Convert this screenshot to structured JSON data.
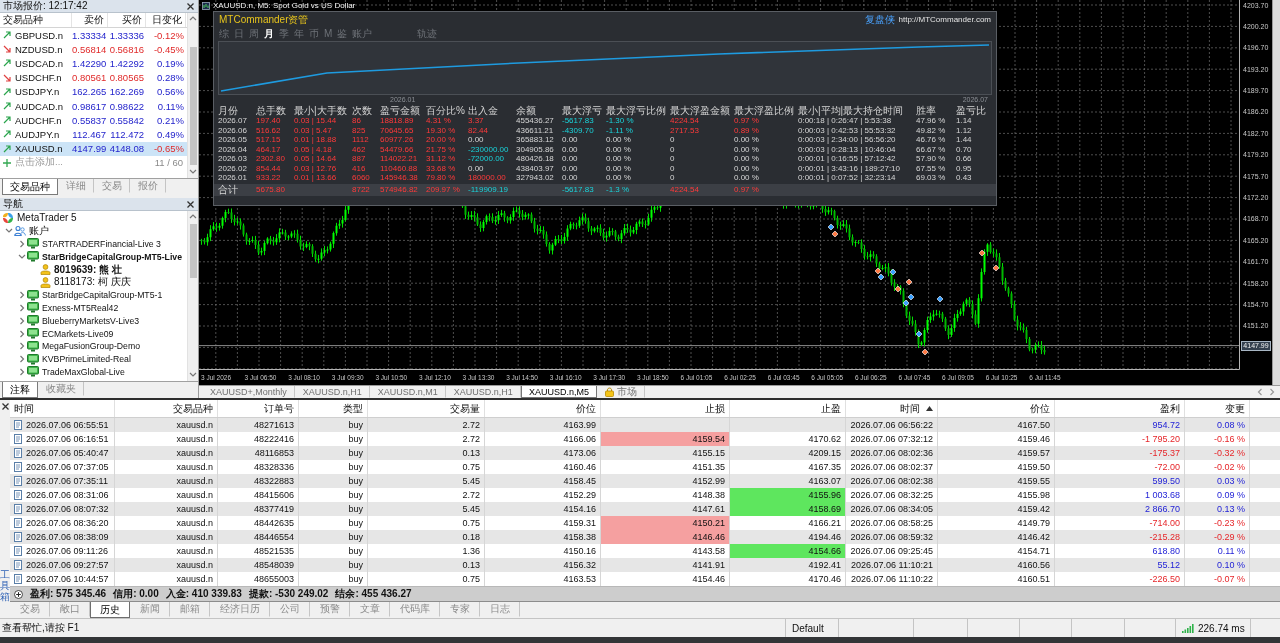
{
  "market_watch": {
    "title": "市场报价: 12:17:42",
    "columns": [
      "交易品种",
      "卖价",
      "买价",
      "日变化"
    ],
    "rows": [
      {
        "symbol": "GBPUSD.n",
        "bid": "1.33334",
        "ask": "1.33336",
        "change": "-0.12%",
        "price_up": true,
        "change_up": false,
        "selected": false
      },
      {
        "symbol": "NZDUSD.n",
        "bid": "0.56814",
        "ask": "0.56816",
        "change": "-0.45%",
        "price_up": false,
        "change_up": false,
        "selected": false
      },
      {
        "symbol": "USDCAD.n",
        "bid": "1.42290",
        "ask": "1.42292",
        "change": "0.19%",
        "price_up": true,
        "change_up": true,
        "selected": false
      },
      {
        "symbol": "USDCHF.n",
        "bid": "0.80561",
        "ask": "0.80565",
        "change": "0.28%",
        "price_up": false,
        "change_up": true,
        "selected": false
      },
      {
        "symbol": "USDJPY.n",
        "bid": "162.265",
        "ask": "162.269",
        "change": "0.56%",
        "price_up": true,
        "change_up": true,
        "selected": false
      },
      {
        "symbol": "AUDCAD.n",
        "bid": "0.98617",
        "ask": "0.98622",
        "change": "0.11%",
        "price_up": true,
        "change_up": true,
        "selected": false
      },
      {
        "symbol": "AUDCHF.n",
        "bid": "0.55837",
        "ask": "0.55842",
        "change": "0.21%",
        "price_up": true,
        "change_up": true,
        "selected": false
      },
      {
        "symbol": "AUDJPY.n",
        "bid": "112.467",
        "ask": "112.472",
        "change": "0.49%",
        "price_up": true,
        "change_up": true,
        "selected": false
      },
      {
        "symbol": "XAUUSD.n",
        "bid": "4147.99",
        "ask": "4148.08",
        "change": "-0.65%",
        "price_up": true,
        "change_up": false,
        "selected": true
      }
    ],
    "add_label": "点击添加...",
    "count": "11 / 60",
    "tabs": [
      {
        "label": "交易品种",
        "selected": true
      },
      {
        "label": "详细",
        "selected": false
      },
      {
        "label": "交易",
        "selected": false
      },
      {
        "label": "报价",
        "selected": false
      }
    ]
  },
  "navigator": {
    "title": "导航",
    "tree": [
      {
        "label": "MetaTrader 5",
        "kind": "app",
        "children": [
          {
            "label": "账户",
            "kind": "folder",
            "expanded": true,
            "children": [
              {
                "label": "STARTRADERFinancial-Live 3",
                "kind": "server",
                "expanded": false,
                "active": false
              },
              {
                "label": "StarBridgeCapitalGroup-MT5-Live",
                "kind": "server",
                "expanded": true,
                "active": true,
                "children": [
                  {
                    "label": "8019639: 熊 壮",
                    "kind": "account",
                    "active": true
                  },
                  {
                    "label": "8118173: 柯 庆庆",
                    "kind": "account",
                    "active": false
                  }
                ]
              },
              {
                "label": "StarBridgeCapitalGroup-MT5-1",
                "kind": "server",
                "expanded": false,
                "active": false
              },
              {
                "label": "Exness-MT5Real42",
                "kind": "server",
                "expanded": false,
                "active": false
              },
              {
                "label": "BlueberryMarketsV-Live3",
                "kind": "server",
                "expanded": false,
                "active": false
              },
              {
                "label": "ECMarkets-Live09",
                "kind": "server",
                "expanded": false,
                "active": false
              },
              {
                "label": "MegaFusionGroup-Demo",
                "kind": "server",
                "expanded": false,
                "active": false
              },
              {
                "label": "KVBPrimeLimited-Real",
                "kind": "server",
                "expanded": false,
                "active": false
              },
              {
                "label": "TradeMaxGlobal-Live",
                "kind": "server",
                "expanded": false,
                "active": false
              }
            ]
          }
        ]
      }
    ],
    "tabs": [
      {
        "label": "注释",
        "selected": true
      },
      {
        "label": "收藏夹",
        "selected": false
      }
    ]
  },
  "chart": {
    "title": "XAUUSD.n, M5: Spot Gold vs US Dollar",
    "price_labels": [
      "4203.70",
      "4200.20",
      "4196.70",
      "4193.20",
      "4189.70",
      "4186.20",
      "4182.70",
      "4179.20",
      "4175.70",
      "4172.20",
      "4168.70",
      "4165.20",
      "4161.70",
      "4158.20",
      "4154.70",
      "4151.20"
    ],
    "current_price": "4147.99",
    "time_labels": [
      "3 Jul 2026",
      "3 Jul 06:50",
      "3 Jul 08:10",
      "3 Jul 09:30",
      "3 Jul 10:50",
      "3 Jul 12:10",
      "3 Jul 13:30",
      "3 Jul 14:50",
      "3 Jul 16:10",
      "3 Jul 17:30",
      "3 Jul 18:50",
      "6 Jul 01:05",
      "6 Jul 02:25",
      "6 Jul 03:45",
      "6 Jul 05:05",
      "6 Jul 06:25",
      "6 Jul 07:45",
      "6 Jul 09:05",
      "6 Jul 10:25",
      "6 Jul 11:45"
    ]
  },
  "commander": {
    "title": "MTCommander资管",
    "brand": "复盘侠",
    "url": "http://MTCommander.com",
    "periods": [
      {
        "label": "综",
        "selected": false
      },
      {
        "label": "日",
        "selected": false
      },
      {
        "label": "周",
        "selected": false
      },
      {
        "label": "月",
        "selected": true
      },
      {
        "label": "季",
        "selected": false
      },
      {
        "label": "年",
        "selected": false
      },
      {
        "label": "币",
        "selected": false
      },
      {
        "label": "M",
        "selected": false
      },
      {
        "label": "鉴",
        "selected": false
      },
      {
        "label": "账户",
        "selected": false
      }
    ],
    "trail_tab": {
      "label": "轨迹",
      "selected": false
    },
    "curve": {
      "start_label": "2026.01",
      "end_label": "2026.07"
    },
    "stats": {
      "columns": [
        "月份",
        "总手数",
        "最小|大手数",
        "次数",
        "盈亏金额",
        "百分比%",
        "出入金",
        "余额",
        "最大浮亏",
        "最大浮亏比例",
        "最大浮盈金额",
        "最大浮盈比例",
        "最小|平均|最大持仓时间",
        "胜率",
        "盈亏比"
      ],
      "rows": [
        [
          {
            "text": "2026.07",
            "kind": "plain"
          },
          {
            "text": "197.40",
            "kind": "gain"
          },
          {
            "text": "0.03 | 15.44",
            "kind": "gain"
          },
          {
            "text": "86",
            "kind": "gain"
          },
          {
            "text": "18818.89",
            "kind": "gain"
          },
          {
            "text": "4.31 %",
            "kind": "gain"
          },
          {
            "text": "3.37",
            "kind": "gain"
          },
          {
            "text": "455436.27",
            "kind": "plain"
          },
          {
            "text": "-5617.83",
            "kind": "loss"
          },
          {
            "text": "-1.30 %",
            "kind": "loss"
          },
          {
            "text": "4224.54",
            "kind": "gain"
          },
          {
            "text": "0.97 %",
            "kind": "gain"
          },
          {
            "text": "0:00:18 | 0:26:47 | 5:53:38",
            "kind": "plain"
          },
          {
            "text": "47.96 %",
            "kind": "plain"
          },
          {
            "text": "1.14",
            "kind": "plain"
          }
        ],
        [
          {
            "text": "2026.06",
            "kind": "plain"
          },
          {
            "text": "516.62",
            "kind": "gain"
          },
          {
            "text": "0.03 | 5.47",
            "kind": "gain"
          },
          {
            "text": "825",
            "kind": "gain"
          },
          {
            "text": "70645.65",
            "kind": "gain"
          },
          {
            "text": "19.30 %",
            "kind": "gain"
          },
          {
            "text": "82.44",
            "kind": "gain"
          },
          {
            "text": "436611.21",
            "kind": "plain"
          },
          {
            "text": "-4309.70",
            "kind": "loss"
          },
          {
            "text": "-1.11 %",
            "kind": "loss"
          },
          {
            "text": "2717.53",
            "kind": "gain"
          },
          {
            "text": "0.89 %",
            "kind": "gain"
          },
          {
            "text": "0:00:03 | 0:42:53 | 55:53:32",
            "kind": "plain"
          },
          {
            "text": "49.82 %",
            "kind": "plain"
          },
          {
            "text": "1.12",
            "kind": "plain"
          }
        ],
        [
          {
            "text": "2026.05",
            "kind": "plain"
          },
          {
            "text": "517.15",
            "kind": "gain"
          },
          {
            "text": "0.01 | 18.88",
            "kind": "gain"
          },
          {
            "text": "1112",
            "kind": "gain"
          },
          {
            "text": "60977.26",
            "kind": "gain"
          },
          {
            "text": "20.00 %",
            "kind": "gain"
          },
          {
            "text": "0.00",
            "kind": "plain"
          },
          {
            "text": "365883.12",
            "kind": "plain"
          },
          {
            "text": "0.00",
            "kind": "plain"
          },
          {
            "text": "0.00 %",
            "kind": "plain"
          },
          {
            "text": "0",
            "kind": "plain"
          },
          {
            "text": "0.00 %",
            "kind": "plain"
          },
          {
            "text": "0:00:03 | 2:34:00 | 56:56:20",
            "kind": "plain"
          },
          {
            "text": "46.76 %",
            "kind": "plain"
          },
          {
            "text": "1.44",
            "kind": "plain"
          }
        ],
        [
          {
            "text": "2026.04",
            "kind": "plain"
          },
          {
            "text": "464.17",
            "kind": "gain"
          },
          {
            "text": "0.05 | 4.18",
            "kind": "gain"
          },
          {
            "text": "462",
            "kind": "gain"
          },
          {
            "text": "54479.66",
            "kind": "gain"
          },
          {
            "text": "21.75 %",
            "kind": "gain"
          },
          {
            "text": "-230000.00",
            "kind": "loss"
          },
          {
            "text": "304905.86",
            "kind": "plain"
          },
          {
            "text": "0.00",
            "kind": "plain"
          },
          {
            "text": "0.00 %",
            "kind": "plain"
          },
          {
            "text": "0",
            "kind": "plain"
          },
          {
            "text": "0.00 %",
            "kind": "plain"
          },
          {
            "text": "0:00:03 | 0:28:13 | 10:46:04",
            "kind": "plain"
          },
          {
            "text": "66.67 %",
            "kind": "plain"
          },
          {
            "text": "0.70",
            "kind": "plain"
          }
        ],
        [
          {
            "text": "2026.03",
            "kind": "plain"
          },
          {
            "text": "2302.80",
            "kind": "gain"
          },
          {
            "text": "0.05 | 14.64",
            "kind": "gain"
          },
          {
            "text": "887",
            "kind": "gain"
          },
          {
            "text": "114022.21",
            "kind": "gain"
          },
          {
            "text": "31.12 %",
            "kind": "gain"
          },
          {
            "text": "-72000.00",
            "kind": "loss"
          },
          {
            "text": "480426.18",
            "kind": "plain"
          },
          {
            "text": "0.00",
            "kind": "plain"
          },
          {
            "text": "0.00 %",
            "kind": "plain"
          },
          {
            "text": "0",
            "kind": "plain"
          },
          {
            "text": "0.00 %",
            "kind": "plain"
          },
          {
            "text": "0:00:01 | 0:16:55 | 57:12:42",
            "kind": "plain"
          },
          {
            "text": "57.90 %",
            "kind": "plain"
          },
          {
            "text": "0.66",
            "kind": "plain"
          }
        ],
        [
          {
            "text": "2026.02",
            "kind": "plain"
          },
          {
            "text": "854.44",
            "kind": "gain"
          },
          {
            "text": "0.03 | 12.76",
            "kind": "gain"
          },
          {
            "text": "416",
            "kind": "gain"
          },
          {
            "text": "110460.88",
            "kind": "gain"
          },
          {
            "text": "33.68 %",
            "kind": "gain"
          },
          {
            "text": "0.00",
            "kind": "plain"
          },
          {
            "text": "438403.97",
            "kind": "plain"
          },
          {
            "text": "0.00",
            "kind": "plain"
          },
          {
            "text": "0.00 %",
            "kind": "plain"
          },
          {
            "text": "0",
            "kind": "plain"
          },
          {
            "text": "0.00 %",
            "kind": "plain"
          },
          {
            "text": "0:00:01 | 3:43:16 | 189:27:10",
            "kind": "plain"
          },
          {
            "text": "67.55 %",
            "kind": "plain"
          },
          {
            "text": "0.95",
            "kind": "plain"
          }
        ],
        [
          {
            "text": "2026.01",
            "kind": "plain"
          },
          {
            "text": "933.22",
            "kind": "gain"
          },
          {
            "text": "0.01 | 13.66",
            "kind": "gain"
          },
          {
            "text": "6060",
            "kind": "gain"
          },
          {
            "text": "145946.38",
            "kind": "gain"
          },
          {
            "text": "79.80 %",
            "kind": "gain"
          },
          {
            "text": "180000.00",
            "kind": "gain"
          },
          {
            "text": "327943.02",
            "kind": "plain"
          },
          {
            "text": "0.00",
            "kind": "plain"
          },
          {
            "text": "0.00 %",
            "kind": "plain"
          },
          {
            "text": "0",
            "kind": "plain"
          },
          {
            "text": "0.00 %",
            "kind": "plain"
          },
          {
            "text": "0:00:01 | 0:07:52 | 32:23:14",
            "kind": "plain"
          },
          {
            "text": "69.03 %",
            "kind": "plain"
          },
          {
            "text": "0.43",
            "kind": "plain"
          }
        ]
      ],
      "total": {
        "label": {
          "text": "合计",
          "kind": "plain"
        },
        "total_lots": {
          "text": "5675.80",
          "kind": "gain"
        },
        "trades": {
          "text": "8722",
          "kind": "gain"
        },
        "profit": {
          "text": "574946.82",
          "kind": "gain"
        },
        "percent": {
          "text": "209.97 %",
          "kind": "gain"
        },
        "deposits": {
          "text": "-119909.19",
          "kind": "loss"
        },
        "max_floating_loss": {
          "text": "-5617.83",
          "kind": "loss"
        },
        "max_floating_loss_pct": {
          "text": "-1.3 %",
          "kind": "loss"
        },
        "max_floating_profit": {
          "text": "4224.54",
          "kind": "gain"
        },
        "max_floating_profit_pct": {
          "text": "0.97 %",
          "kind": "gain"
        }
      }
    }
  },
  "chart_tabs": [
    {
      "label": "XAUUSD+,Monthly",
      "kind": "chart",
      "selected": false
    },
    {
      "label": "XAUUSD.n,H1",
      "kind": "chart",
      "selected": false
    },
    {
      "label": "XAUUSD.n,M1",
      "kind": "chart",
      "selected": false
    },
    {
      "label": "XAUUSD.n,H1",
      "kind": "chart",
      "selected": false
    },
    {
      "label": "XAUUSD.n,M5",
      "kind": "chart",
      "selected": true
    },
    {
      "label": "市场",
      "kind": "market",
      "selected": false
    }
  ],
  "toolbox": {
    "label": "工具箱",
    "columns": [
      {
        "label": "时间",
        "sorted": false
      },
      {
        "label": "交易品种",
        "sorted": false
      },
      {
        "label": "订单号",
        "sorted": false
      },
      {
        "label": "类型",
        "sorted": false
      },
      {
        "label": "交易量",
        "sorted": false
      },
      {
        "label": "价位",
        "sorted": false
      },
      {
        "label": "止损",
        "sorted": false
      },
      {
        "label": "止盈",
        "sorted": false
      },
      {
        "label": "时间",
        "sorted": true
      },
      {
        "label": "价位",
        "sorted": false
      },
      {
        "label": "盈利",
        "sorted": false
      },
      {
        "label": "变更",
        "sorted": false
      }
    ],
    "rows": [
      {
        "open_time": "2026.07.06 06:55:51",
        "symbol": "xauusd.n",
        "order": "48271613",
        "type": "buy",
        "volume": "2.72",
        "open_price": "4163.99",
        "close_time": "2026.07.06 06:56:22",
        "close_price": "4167.50",
        "profit": "954.72",
        "change": "0.08 %",
        "sl_hit": false,
        "tp_hit": false,
        "loss": false
      },
      {
        "open_time": "2026.07.06 06:16:51",
        "symbol": "xauusd.n",
        "order": "48222416",
        "type": "buy",
        "volume": "2.72",
        "open_price": "4166.06",
        "sl": "4159.54",
        "tp": "4170.62",
        "close_time": "2026.07.06 07:32:12",
        "close_price": "4159.46",
        "profit": "-1 795.20",
        "change": "-0.16 %",
        "sl_hit": true,
        "tp_hit": false,
        "loss": true
      },
      {
        "open_time": "2026.07.06 05:40:47",
        "symbol": "xauusd.n",
        "order": "48116853",
        "type": "buy",
        "volume": "0.13",
        "open_price": "4173.06",
        "sl": "4155.15",
        "tp": "4209.15",
        "close_time": "2026.07.06 08:02:36",
        "close_price": "4159.57",
        "profit": "-175.37",
        "change": "-0.32 %",
        "sl_hit": false,
        "tp_hit": false,
        "loss": true
      },
      {
        "open_time": "2026.07.06 07:37:05",
        "symbol": "xauusd.n",
        "order": "48328336",
        "type": "buy",
        "volume": "0.75",
        "open_price": "4160.46",
        "sl": "4151.35",
        "tp": "4167.35",
        "close_time": "2026.07.06 08:02:37",
        "close_price": "4159.50",
        "profit": "-72.00",
        "change": "-0.02 %",
        "sl_hit": false,
        "tp_hit": false,
        "loss": true
      },
      {
        "open_time": "2026.07.06 07:35:11",
        "symbol": "xauusd.n",
        "order": "48322883",
        "type": "buy",
        "volume": "5.45",
        "open_price": "4158.45",
        "sl": "4152.99",
        "tp": "4163.07",
        "close_time": "2026.07.06 08:02:38",
        "close_price": "4159.55",
        "profit": "599.50",
        "change": "0.03 %",
        "sl_hit": false,
        "tp_hit": false,
        "loss": false
      },
      {
        "open_time": "2026.07.06 08:31:06",
        "symbol": "xauusd.n",
        "order": "48415606",
        "type": "buy",
        "volume": "2.72",
        "open_price": "4152.29",
        "sl": "4148.38",
        "tp": "4155.96",
        "close_time": "2026.07.06 08:32:25",
        "close_price": "4155.98",
        "profit": "1 003.68",
        "change": "0.09 %",
        "sl_hit": false,
        "tp_hit": true,
        "loss": false
      },
      {
        "open_time": "2026.07.06 08:07:32",
        "symbol": "xauusd.n",
        "order": "48377419",
        "type": "buy",
        "volume": "5.45",
        "open_price": "4154.16",
        "sl": "4147.61",
        "tp": "4158.69",
        "close_time": "2026.07.06 08:34:05",
        "close_price": "4159.42",
        "profit": "2 866.70",
        "change": "0.13 %",
        "sl_hit": false,
        "tp_hit": true,
        "loss": false
      },
      {
        "open_time": "2026.07.06 08:36:20",
        "symbol": "xauusd.n",
        "order": "48442635",
        "type": "buy",
        "volume": "0.75",
        "open_price": "4159.31",
        "sl": "4150.21",
        "tp": "4166.21",
        "close_time": "2026.07.06 08:58:25",
        "close_price": "4149.79",
        "profit": "-714.00",
        "change": "-0.23 %",
        "sl_hit": true,
        "tp_hit": false,
        "loss": true
      },
      {
        "open_time": "2026.07.06 08:38:09",
        "symbol": "xauusd.n",
        "order": "48446554",
        "type": "buy",
        "volume": "0.18",
        "open_price": "4158.38",
        "sl": "4146.46",
        "tp": "4194.46",
        "close_time": "2026.07.06 08:59:32",
        "close_price": "4146.42",
        "profit": "-215.28",
        "change": "-0.29 %",
        "sl_hit": true,
        "tp_hit": false,
        "loss": true
      },
      {
        "open_time": "2026.07.06 09:11:26",
        "symbol": "xauusd.n",
        "order": "48521535",
        "type": "buy",
        "volume": "1.36",
        "open_price": "4150.16",
        "sl": "4143.58",
        "tp": "4154.66",
        "close_time": "2026.07.06 09:25:45",
        "close_price": "4154.71",
        "profit": "618.80",
        "change": "0.11 %",
        "sl_hit": false,
        "tp_hit": true,
        "loss": false
      },
      {
        "open_time": "2026.07.06 09:27:57",
        "symbol": "xauusd.n",
        "order": "48548039",
        "type": "buy",
        "volume": "0.13",
        "open_price": "4156.32",
        "sl": "4141.91",
        "tp": "4192.41",
        "close_time": "2026.07.06 11:10:21",
        "close_price": "4160.56",
        "profit": "55.12",
        "change": "0.10 %",
        "sl_hit": false,
        "tp_hit": false,
        "loss": false
      },
      {
        "open_time": "2026.07.06 10:44:57",
        "symbol": "xauusd.n",
        "order": "48655003",
        "type": "buy",
        "volume": "0.75",
        "open_price": "4163.53",
        "sl": "4154.46",
        "tp": "4170.46",
        "close_time": "2026.07.06 11:10:22",
        "close_price": "4160.51",
        "profit": "-226.50",
        "change": "-0.07 %",
        "sl_hit": false,
        "tp_hit": false,
        "loss": true
      }
    ],
    "summary": [
      "盈利: 575 345.46",
      "信用: 0.00",
      "入金: 410 339.83",
      "提款: -530 249.02",
      "结余: 455 436.27"
    ],
    "tabs": [
      {
        "label": "交易",
        "selected": false
      },
      {
        "label": "敞口",
        "selected": false
      },
      {
        "label": "历史",
        "selected": true
      },
      {
        "label": "新闻",
        "selected": false
      },
      {
        "label": "邮箱",
        "selected": false
      },
      {
        "label": "经济日历",
        "selected": false
      },
      {
        "label": "公司",
        "selected": false
      },
      {
        "label": "预警",
        "selected": false
      },
      {
        "label": "文章",
        "selected": false
      },
      {
        "label": "代码库",
        "selected": false
      },
      {
        "label": "专家",
        "selected": false
      },
      {
        "label": "日志",
        "selected": false
      }
    ]
  },
  "status_bar": {
    "help": "查看帮忙,请按 F1",
    "profile": "Default",
    "ping": "226.74 ms"
  }
}
